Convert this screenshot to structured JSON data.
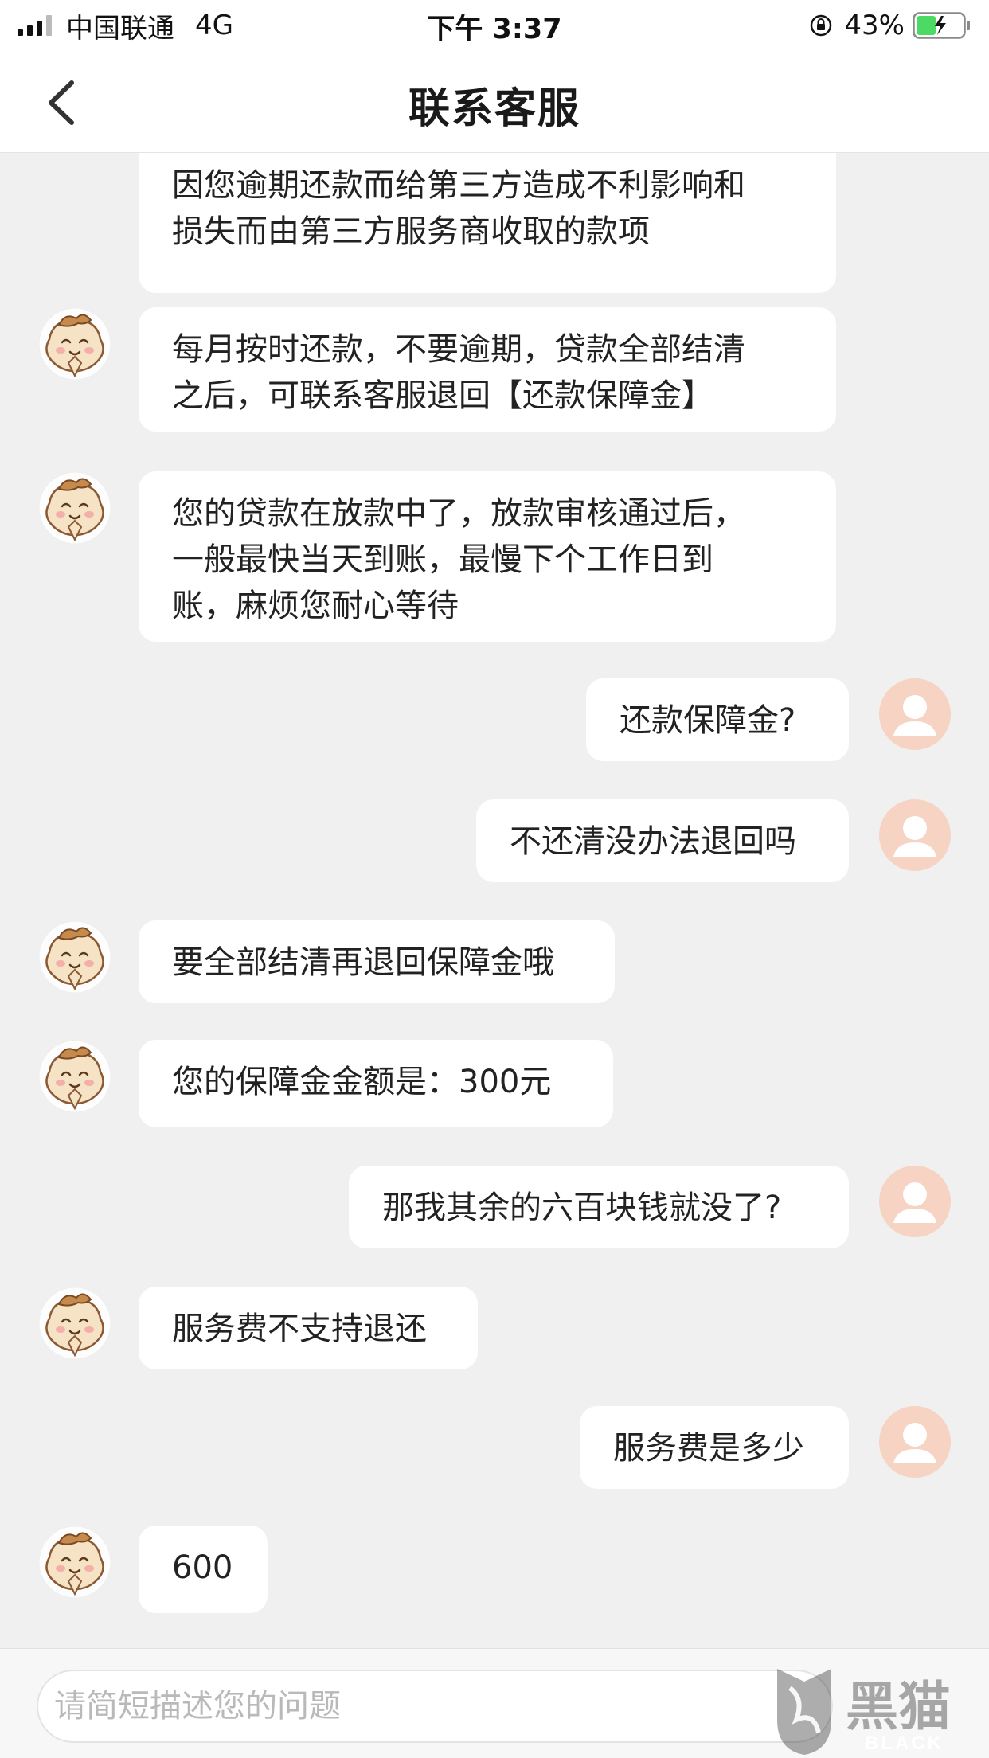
{
  "status_bar": {
    "carrier": "中国联通",
    "network": "4G",
    "time": "下午 3:37",
    "battery_percent": "43%",
    "battery_level": 0.43
  },
  "nav": {
    "title": "联系客服"
  },
  "messages": [
    {
      "sender": "agent",
      "text": "因您逾期还款而给第三方造成不利影响和\n损失而由第三方服务商收取的款项"
    },
    {
      "sender": "agent",
      "text": "每月按时还款，不要逾期，贷款全部结清\n之后，可联系客服退回【还款保障金】"
    },
    {
      "sender": "agent",
      "text": "您的贷款在放款中了，放款审核通过后，\n一般最快当天到账，最慢下个工作日到\n账，麻烦您耐心等待"
    },
    {
      "sender": "user",
      "text": "还款保障金?"
    },
    {
      "sender": "user",
      "text": "不还清没办法退回吗"
    },
    {
      "sender": "agent",
      "text": "要全部结清再退回保障金哦"
    },
    {
      "sender": "agent",
      "text": "您的保障金金额是：300元"
    },
    {
      "sender": "user",
      "text": "那我其余的六百块钱就没了?"
    },
    {
      "sender": "agent",
      "text": "服务费不支持退还"
    },
    {
      "sender": "user",
      "text": "服务费是多少"
    },
    {
      "sender": "agent",
      "text": "600"
    }
  ],
  "input": {
    "placeholder": "请简短描述您的问题"
  },
  "watermark": {
    "brand_text": "BLACK CAT",
    "logo_text": "黑猫"
  },
  "colors": {
    "background": "#f0f0f0",
    "bubble": "#ffffff",
    "user_avatar": "#f6d3c2",
    "battery_green": "#4cd964"
  }
}
